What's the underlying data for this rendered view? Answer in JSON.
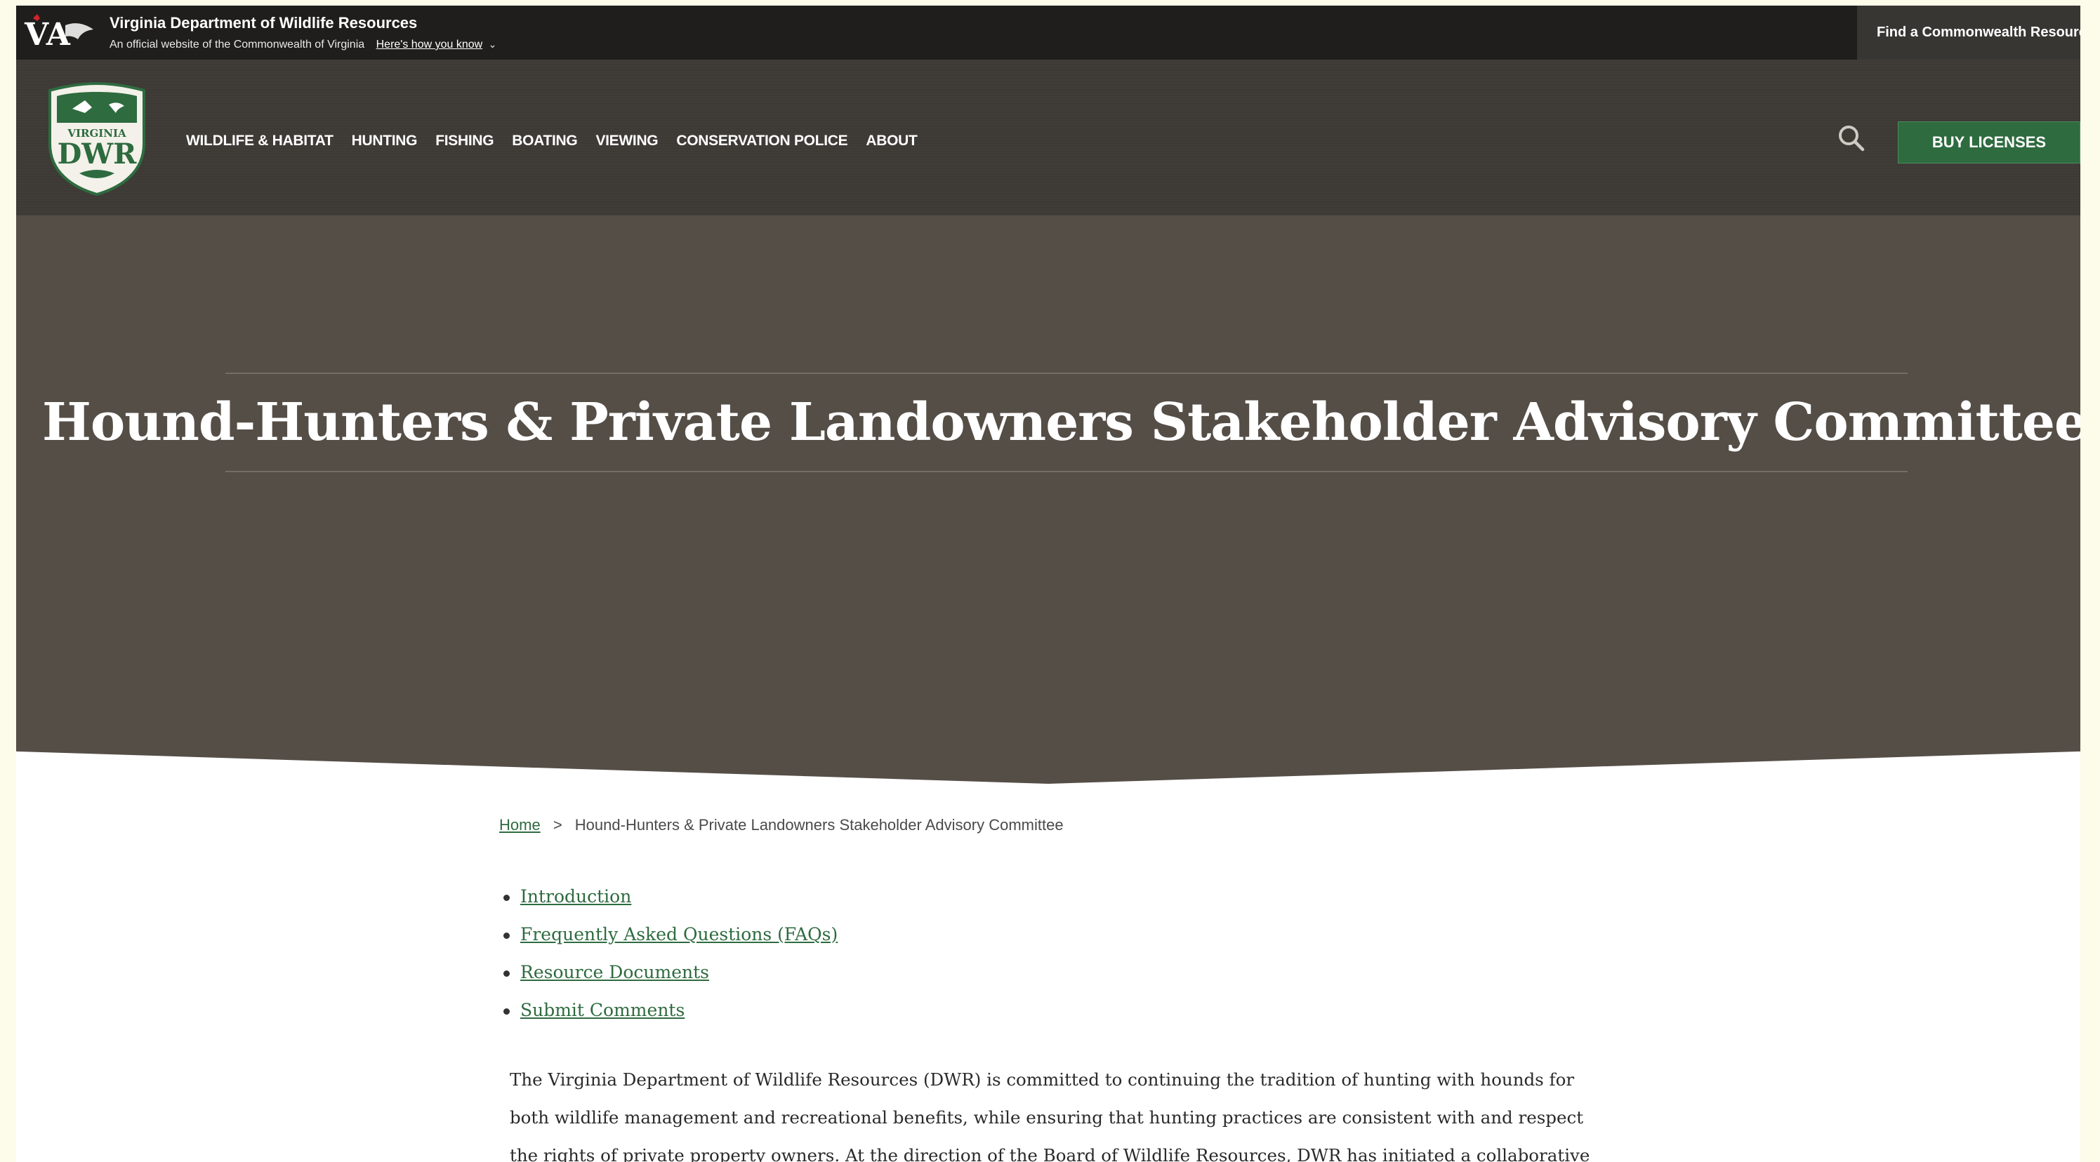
{
  "gov_bar": {
    "title": "Virginia Department of Wildlife Resources",
    "subtitle": "An official website of the Commonwealth of Virginia",
    "how_link": "Here's how you know",
    "find_resource": "Find a Commonwealth Resource"
  },
  "nav": {
    "items": [
      {
        "label": "WILDLIFE & HABITAT"
      },
      {
        "label": "HUNTING"
      },
      {
        "label": "FISHING"
      },
      {
        "label": "BOATING"
      },
      {
        "label": "VIEWING"
      },
      {
        "label": "CONSERVATION POLICE"
      },
      {
        "label": "ABOUT"
      }
    ],
    "buy_label": "BUY LICENSES",
    "logo": {
      "top": "VIRGINIA",
      "main": "DWR"
    }
  },
  "hero": {
    "title": "Hound-Hunters & Private Landowners Stakeholder Advisory Committee"
  },
  "breadcrumb": {
    "home": "Home",
    "separator": ">",
    "current": "Hound-Hunters & Private Landowners Stakeholder Advisory Committee"
  },
  "toc": [
    {
      "label": "Introduction"
    },
    {
      "label": "Frequently Asked Questions (FAQs)"
    },
    {
      "label": "Resource Documents"
    },
    {
      "label": "Submit Comments"
    }
  ],
  "intro_text": "The Virginia Department of Wildlife Resources (DWR) is committed to continuing the tradition of hunting with hounds for both wildlife management and recreational benefits, while ensuring that hunting practices are consistent with and respect the rights of private property owners. At the direction of the Board of Wildlife Resources, DWR has initiated a collaborative stakeholder process.",
  "colors": {
    "dark_bar": "#1f1e1d",
    "nav_bg": "#3d3935",
    "hero_bg": "#554e47",
    "brand_green": "#2e6b3f"
  },
  "icons": [
    "va-flag-logo",
    "dwr-shield-logo",
    "globe-icon",
    "search-icon",
    "chevron-down-icon"
  ]
}
